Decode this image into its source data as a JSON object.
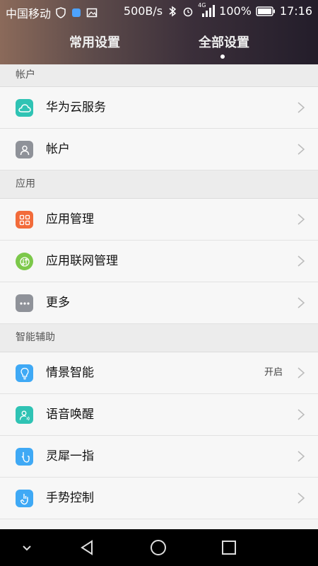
{
  "status_bar": {
    "carrier": "中国移动",
    "speed": "500B/s",
    "network": "4G",
    "battery": "100%",
    "time": "17:16"
  },
  "tabs": [
    {
      "label": "常用设置",
      "active": false
    },
    {
      "label": "全部设置",
      "active": true
    }
  ],
  "sections": [
    {
      "title": "帐户",
      "items": [
        {
          "label": "华为云服务",
          "icon": "cloud-icon",
          "color": "#2fc3b4"
        },
        {
          "label": "帐户",
          "icon": "user-icon",
          "color": "#8f9299"
        }
      ]
    },
    {
      "title": "应用",
      "items": [
        {
          "label": "应用管理",
          "icon": "apps-grid-icon",
          "color": "#f26b3a"
        },
        {
          "label": "应用联网管理",
          "icon": "network-icon",
          "color": "#7cc84a"
        },
        {
          "label": "更多",
          "icon": "more-dots-icon",
          "color": "#8f9299"
        }
      ]
    },
    {
      "title": "智能辅助",
      "items": [
        {
          "label": "情景智能",
          "icon": "bulb-icon",
          "color": "#3fa9f5",
          "value": "开启"
        },
        {
          "label": "语音唤醒",
          "icon": "voice-user-icon",
          "color": "#2fc3b4"
        },
        {
          "label": "灵犀一指",
          "icon": "knuckle-icon",
          "color": "#3fa9f5"
        },
        {
          "label": "手势控制",
          "icon": "gesture-hand-icon",
          "color": "#3fa9f5"
        }
      ]
    }
  ],
  "colors": {
    "header_dark": "#231d2a",
    "navbar": "#000000"
  }
}
